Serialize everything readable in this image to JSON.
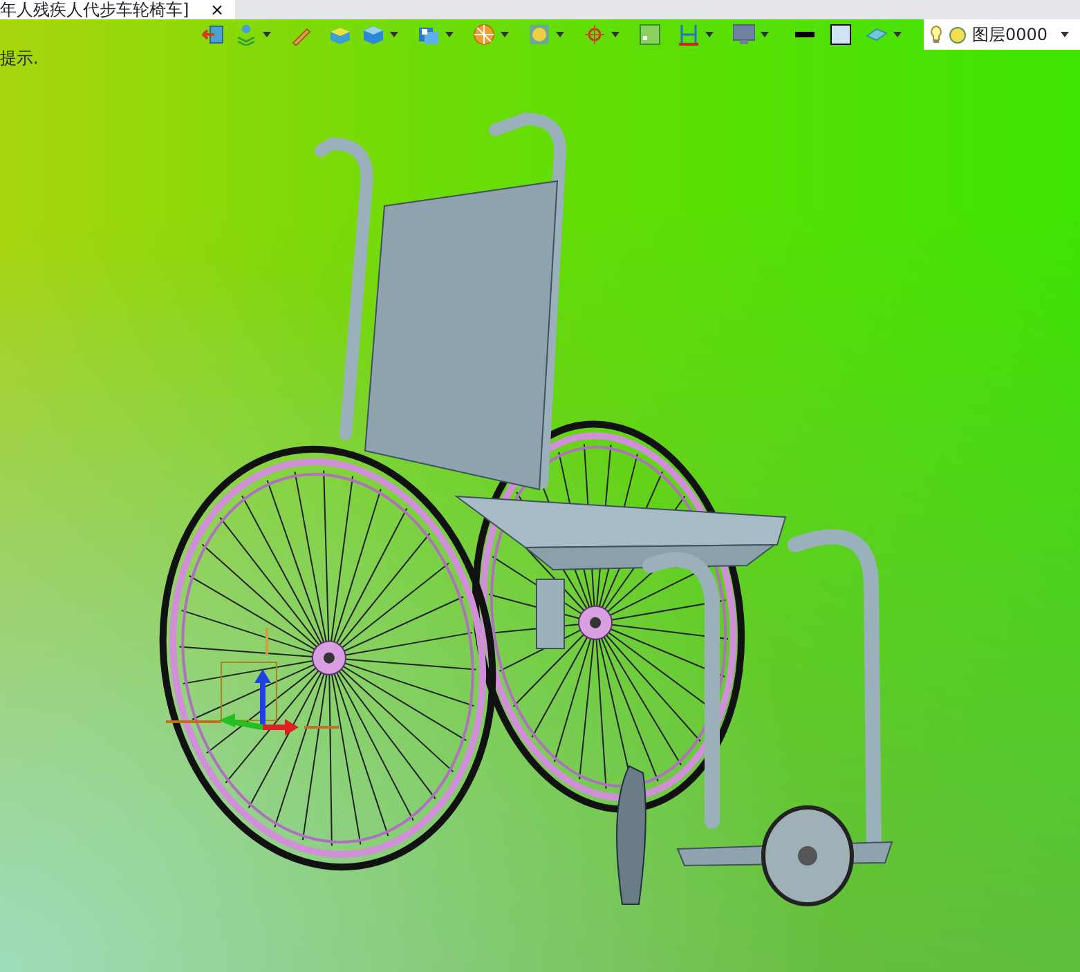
{
  "tab": {
    "title": "年人残疾人代步车轮椅车]",
    "close": "×"
  },
  "prompt": "提示.",
  "layer": {
    "text": "图层0000"
  }
}
